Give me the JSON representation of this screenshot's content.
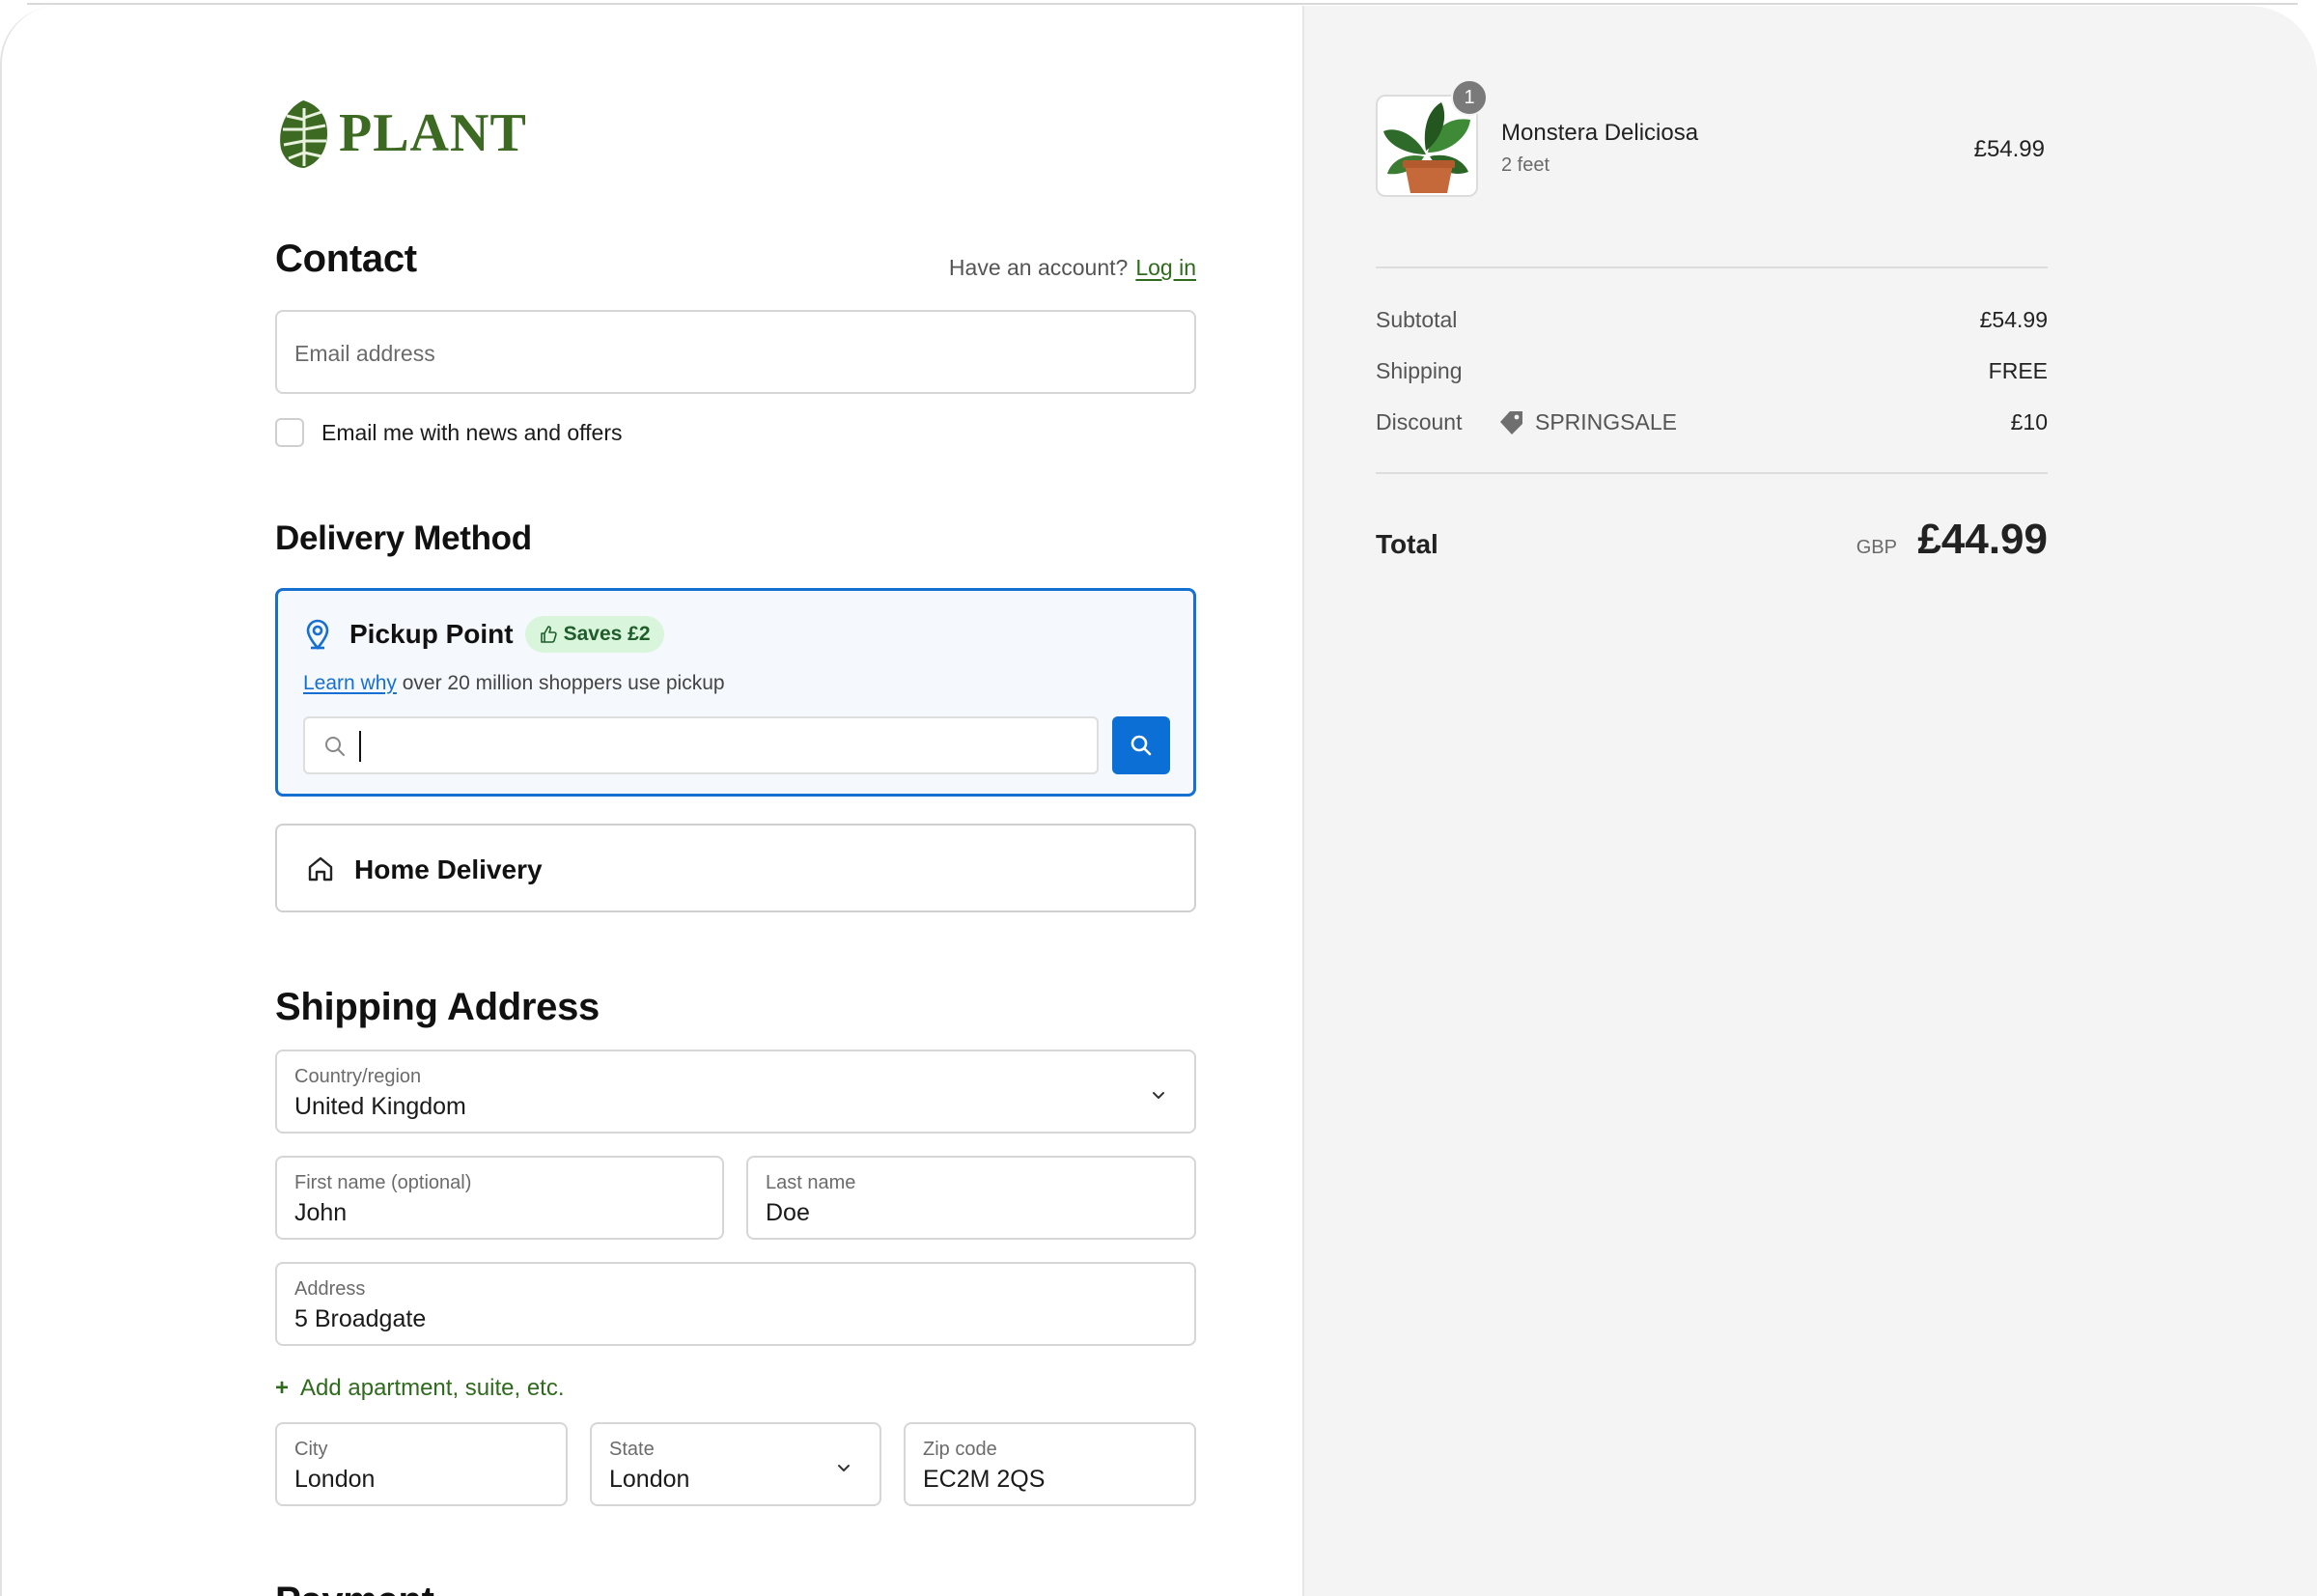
{
  "brand": {
    "name": "PLANT",
    "color": "#3d6a22"
  },
  "contact": {
    "title": "Contact",
    "account_prompt": "Have an account?",
    "login_label": "Log in",
    "email_placeholder": "Email address",
    "newsletter_label": "Email me with news and offers",
    "newsletter_checked": false
  },
  "delivery": {
    "title": "Delivery Method",
    "pickup": {
      "label": "Pickup Point",
      "badge": "Saves £2",
      "learn_link": "Learn why",
      "info_text": "over 20 million shoppers use pickup",
      "search_value": "",
      "selected": true
    },
    "home": {
      "label": "Home Delivery",
      "selected": false
    }
  },
  "shipping": {
    "title": "Shipping Address",
    "country": {
      "label": "Country/region",
      "value": "United Kingdom"
    },
    "first_name": {
      "label": "First name (optional)",
      "value": "John"
    },
    "last_name": {
      "label": "Last name",
      "value": "Doe"
    },
    "address": {
      "label": "Address",
      "value": "5 Broadgate"
    },
    "add_apartment": "Add apartment, suite, etc.",
    "city": {
      "label": "City",
      "value": "London"
    },
    "state": {
      "label": "State",
      "value": "London"
    },
    "zip": {
      "label": "Zip code",
      "value": "EC2M 2QS"
    }
  },
  "payment": {
    "title": "Payment"
  },
  "summary": {
    "product": {
      "name": "Monstera Deliciosa",
      "variant": "2 feet",
      "price": "£54.99",
      "quantity": "1"
    },
    "subtotal": {
      "label": "Subtotal",
      "value": "£54.99"
    },
    "shipping": {
      "label": "Shipping",
      "value": "FREE"
    },
    "discount": {
      "label": "Discount",
      "code": "SPRINGSALE",
      "value": "£10"
    },
    "total": {
      "label": "Total",
      "currency": "GBP",
      "value": "£44.99"
    }
  },
  "colors": {
    "accent_blue": "#1670d1",
    "accent_green": "#2f6b1c",
    "badge_bg": "#d9f5dc",
    "summary_bg": "#f4f4f4"
  }
}
